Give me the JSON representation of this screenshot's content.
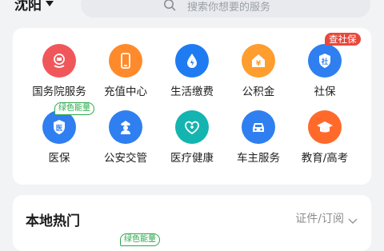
{
  "header": {
    "city": "沈阳",
    "search_placeholder": "搜索你想要的服务"
  },
  "services": [
    {
      "label": "国务院服务",
      "icon": "state-council-emblem-icon",
      "color": "#f0575b"
    },
    {
      "label": "充值中心",
      "icon": "phone-icon",
      "color": "#ff8a2b"
    },
    {
      "label": "生活缴费",
      "icon": "water-drop-bolt-icon",
      "color": "#1f7bf2"
    },
    {
      "label": "公积金",
      "icon": "house-yuan-icon",
      "color": "#ff9d2e"
    },
    {
      "label": "社保",
      "icon": "shield-she-icon",
      "color": "#2f7ff0",
      "badge": "查社保"
    },
    {
      "label": "医保",
      "icon": "shield-yi-icon",
      "color": "#2f7ff0",
      "badge": "绿色能量"
    },
    {
      "label": "公安交管",
      "icon": "police-icon",
      "color": "#2f7ff0"
    },
    {
      "label": "医疗健康",
      "icon": "medical-kit-icon",
      "color": "#14b4b0"
    },
    {
      "label": "车主服务",
      "icon": "car-icon",
      "color": "#2f7ff0"
    },
    {
      "label": "教育/高考",
      "icon": "graduation-cap-icon",
      "color": "#ff6a2b"
    }
  ],
  "local_hot": {
    "title": "本地热门",
    "filter": "证件/订阅",
    "peek_badge": "绿色能量"
  }
}
